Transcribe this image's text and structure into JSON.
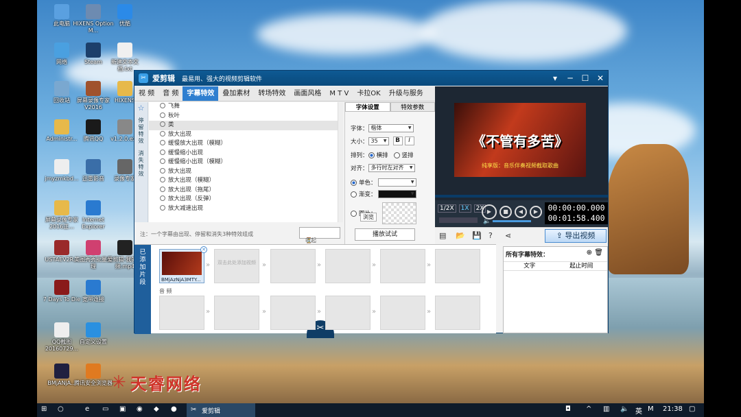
{
  "desktop": {
    "icons": [
      {
        "label": "此电脑",
        "icon": "computer-icon",
        "color": "#5aa0e0"
      },
      {
        "label": "HIXENS Option M...",
        "icon": "app-icon",
        "color": "#6d8bb1"
      },
      {
        "label": "优酷",
        "icon": "youku-icon",
        "color": "#2b8ae8"
      },
      {
        "label": "网络",
        "icon": "network-icon",
        "color": "#4aa0e0"
      },
      {
        "label": "Steam",
        "icon": "steam-icon",
        "color": "#1c3f6b"
      },
      {
        "label": "新建文本文档.txt",
        "icon": "text-file-icon",
        "color": "#f0f0f0"
      },
      {
        "label": "回收站",
        "icon": "recycle-bin-icon",
        "color": "#7aa8d0"
      },
      {
        "label": "屏幕录像专家V2016",
        "icon": "recorder-icon",
        "color": "#a0522d"
      },
      {
        "label": "HIXENS",
        "icon": "folder-icon",
        "color": "#e7b94a"
      },
      {
        "label": "Administr...",
        "icon": "user-folder-icon",
        "color": "#e7b94a"
      },
      {
        "label": "腾讯QQ",
        "icon": "qq-icon",
        "color": "#1a1a1a"
      },
      {
        "label": "v1.2.0.exe",
        "icon": "exe-icon",
        "color": "#888888"
      },
      {
        "label": "jmyzmkbd...",
        "icon": "file-icon",
        "color": "#eeeeee"
      },
      {
        "label": "迅雷影音",
        "icon": "player-icon",
        "color": "#3a6ea8"
      },
      {
        "label": "录像专家",
        "icon": "film-icon",
        "color": "#666666"
      },
      {
        "label": "屏幕录像专家2016正...",
        "icon": "folder-icon",
        "color": "#e7b94a"
      },
      {
        "label": "Internet Explorer",
        "icon": "ie-icon",
        "color": "#2a7ad0"
      },
      {
        "label": "美图秀秀批量处理",
        "icon": "meitu-icon",
        "color": "#d04070"
      },
      {
        "label": "USTAEV2R...",
        "icon": "archive-icon",
        "color": "#9a2a2a"
      },
      {
        "label": "爱剪辑-我的视频.mp4",
        "icon": "video-file-icon",
        "color": "#222222"
      },
      {
        "label": "7 Days To Die",
        "icon": "game-icon",
        "color": "#8a1a1a"
      },
      {
        "label": "宽带连接",
        "icon": "broadband-icon",
        "color": "#2a7ad0"
      },
      {
        "label": "QQ截图20160729...",
        "icon": "image-icon",
        "color": "#eeeeee"
      },
      {
        "label": "自定义设置",
        "icon": "settings-icon",
        "color": "#2a90e0"
      },
      {
        "label": "BMjANjA...",
        "icon": "video-file-icon",
        "color": "#202040"
      },
      {
        "label": "腾讯安全浏览器",
        "icon": "browser-icon",
        "color": "#e07a20"
      }
    ]
  },
  "app": {
    "title": "爱剪辑",
    "subtitle": "最易用、强大的视频剪辑软件",
    "tabs": [
      "视 频",
      "音 频",
      "字幕特效",
      "叠加素材",
      "转场特效",
      "画面风格",
      "M T V",
      "卡拉OK",
      "升级与服务"
    ],
    "active_tab": 2,
    "side_tabs": [
      "停留特效",
      "消失特效"
    ],
    "effects": [
      "飞舞",
      "秋叶",
      "类",
      "放大出现",
      "缓慢放大出现（模糊）",
      "缓慢缩小出现",
      "缓慢缩小出现（模糊）",
      "放大出现",
      "放大出现（模糊）",
      "放大出现（拖尾）",
      "放大出现（反弹）",
      "放大减速出现"
    ],
    "selected_effect": 2,
    "note": "注：一个字幕由出现、停留和消失3种特效组成",
    "collect_label": "收起",
    "font_panel": {
      "tabs": [
        "字体设置",
        "特效参数"
      ],
      "font_label": "字体：",
      "font_value": "楷体",
      "size_label": "大小：",
      "size_value": "35",
      "bold": "B",
      "italic": "I",
      "arrange_label": "排列：",
      "arrange_h": "横排",
      "arrange_v": "竖排",
      "align_label": "对齐：",
      "align_value": "多行时左对齐",
      "solid_label": "单色：",
      "gradient_label": "渐变：",
      "image_label": "图片：",
      "browse_label": "浏览",
      "preview_label": "播放试试"
    },
    "player": {
      "caption": "《不管有多苦》",
      "caption_sub": "纯享版：音乐伴奏视频截取歌曲",
      "zoom": [
        "1/2X",
        "1X",
        "2X"
      ],
      "current_time": "00:00:00.000",
      "total_time": "00:01:58.400",
      "export_label": "导出视频"
    },
    "timeline": {
      "header": "已添加片段",
      "clip_label": "BMjAzNjA3MTY...",
      "add_hint": "双击此处添加视频",
      "audio_label": "音 频"
    },
    "subtitle_panel": {
      "title": "所有字幕特效：",
      "col_text": "文字",
      "col_time": "起止时间"
    }
  },
  "watermark": {
    "text": "天睿网络"
  },
  "taskbar": {
    "app_label": "爱剪辑",
    "ime": "英",
    "ime2": "M",
    "clock": "21:38"
  }
}
